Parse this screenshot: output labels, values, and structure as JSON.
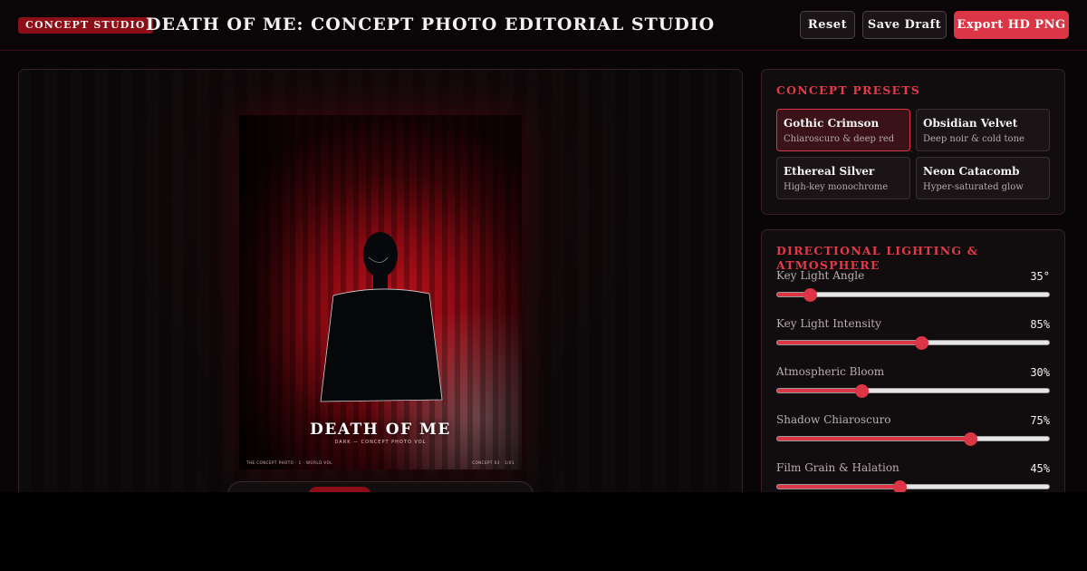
{
  "header": {
    "badge": "CONCEPT STUDIO",
    "title": "DEATH OF ME: CONCEPT PHOTO EDITORIAL STUDIO",
    "buttons": {
      "reset": "Reset",
      "save": "Save Draft",
      "export": "Export HD PNG"
    }
  },
  "poster": {
    "title": "DEATH OF ME",
    "subtitle": "DARK — CONCEPT PHOTO VOL",
    "footer_left": "THE CONCEPT PHOTO · 1 · WORLD VOL",
    "footer_right": "CONCEPT 03 · 1/01"
  },
  "presets": {
    "title": "CONCEPT PRESETS",
    "items": [
      {
        "name": "Gothic Crimson",
        "desc": "Chiaroscuro & deep red",
        "active": true
      },
      {
        "name": "Obsidian Velvet",
        "desc": "Deep noir & cold tone",
        "active": false
      },
      {
        "name": "Ethereal Silver",
        "desc": "High-key monochrome",
        "active": false
      },
      {
        "name": "Neon Catacomb",
        "desc": "Hyper-saturated glow",
        "active": false
      }
    ]
  },
  "lighting": {
    "title": "DIRECTIONAL LIGHTING & ATMOSPHERE",
    "sliders": [
      {
        "label": "Key Light Angle",
        "value": "35°",
        "level": 0.12
      },
      {
        "label": "Key Light Intensity",
        "value": "85%",
        "level": 0.53
      },
      {
        "label": "Atmospheric Bloom",
        "value": "30%",
        "level": 0.31
      },
      {
        "label": "Shadow Chiaroscuro",
        "value": "75%",
        "level": 0.71
      },
      {
        "label": "Film Grain & Halation",
        "value": "45%",
        "level": 0.45
      }
    ]
  },
  "colors": {
    "accent": "#dc3545",
    "brand_dark": "#8c0f18",
    "background": "#080506"
  }
}
